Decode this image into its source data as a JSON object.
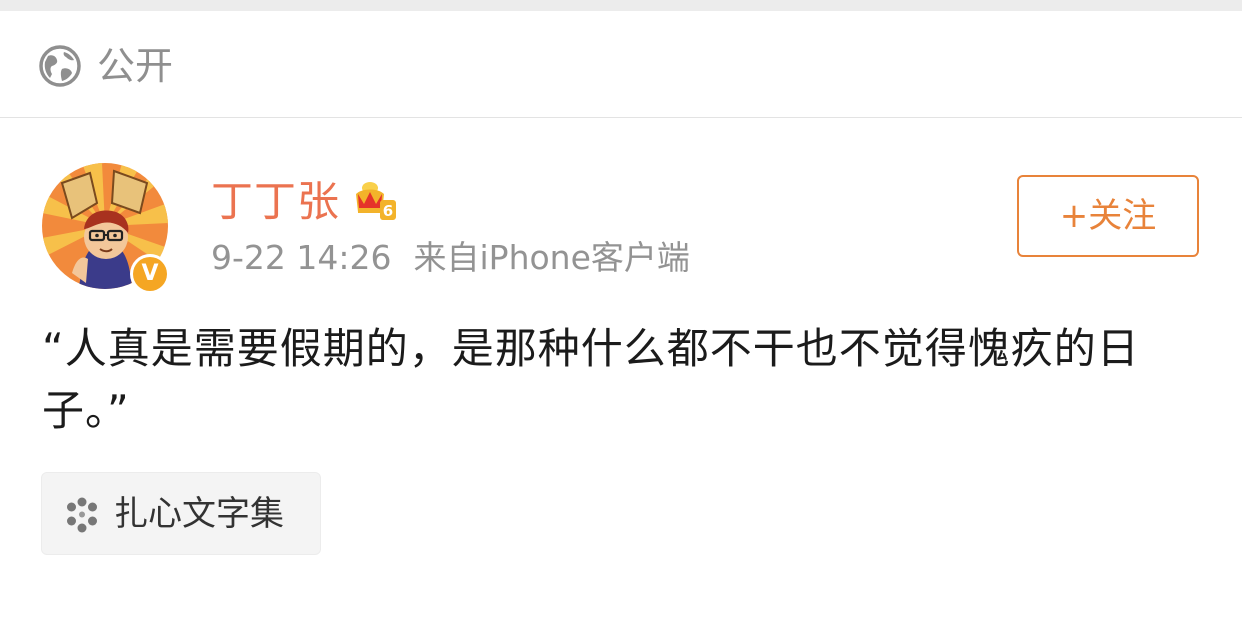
{
  "visibility": {
    "icon": "globe-icon",
    "label": "公开"
  },
  "post": {
    "author": {
      "name": "丁丁张",
      "avatar": "avatar",
      "verified_badge": "V",
      "vip_icon": "crown-icon",
      "vip_level": "6"
    },
    "time": "9-22 14:26",
    "source": "来自iPhone客户端",
    "follow_label": "+关注",
    "text": "“人真是需要假期的，是那种什么都不干也不觉得愧疚的日子。”",
    "topic": {
      "icon": "flower-icon",
      "label": "扎心文字集"
    }
  },
  "colors": {
    "accent_orange": "#eb7350",
    "follow_orange": "#e8833a",
    "meta_gray": "#939393",
    "badge_yellow": "#f5a623"
  }
}
